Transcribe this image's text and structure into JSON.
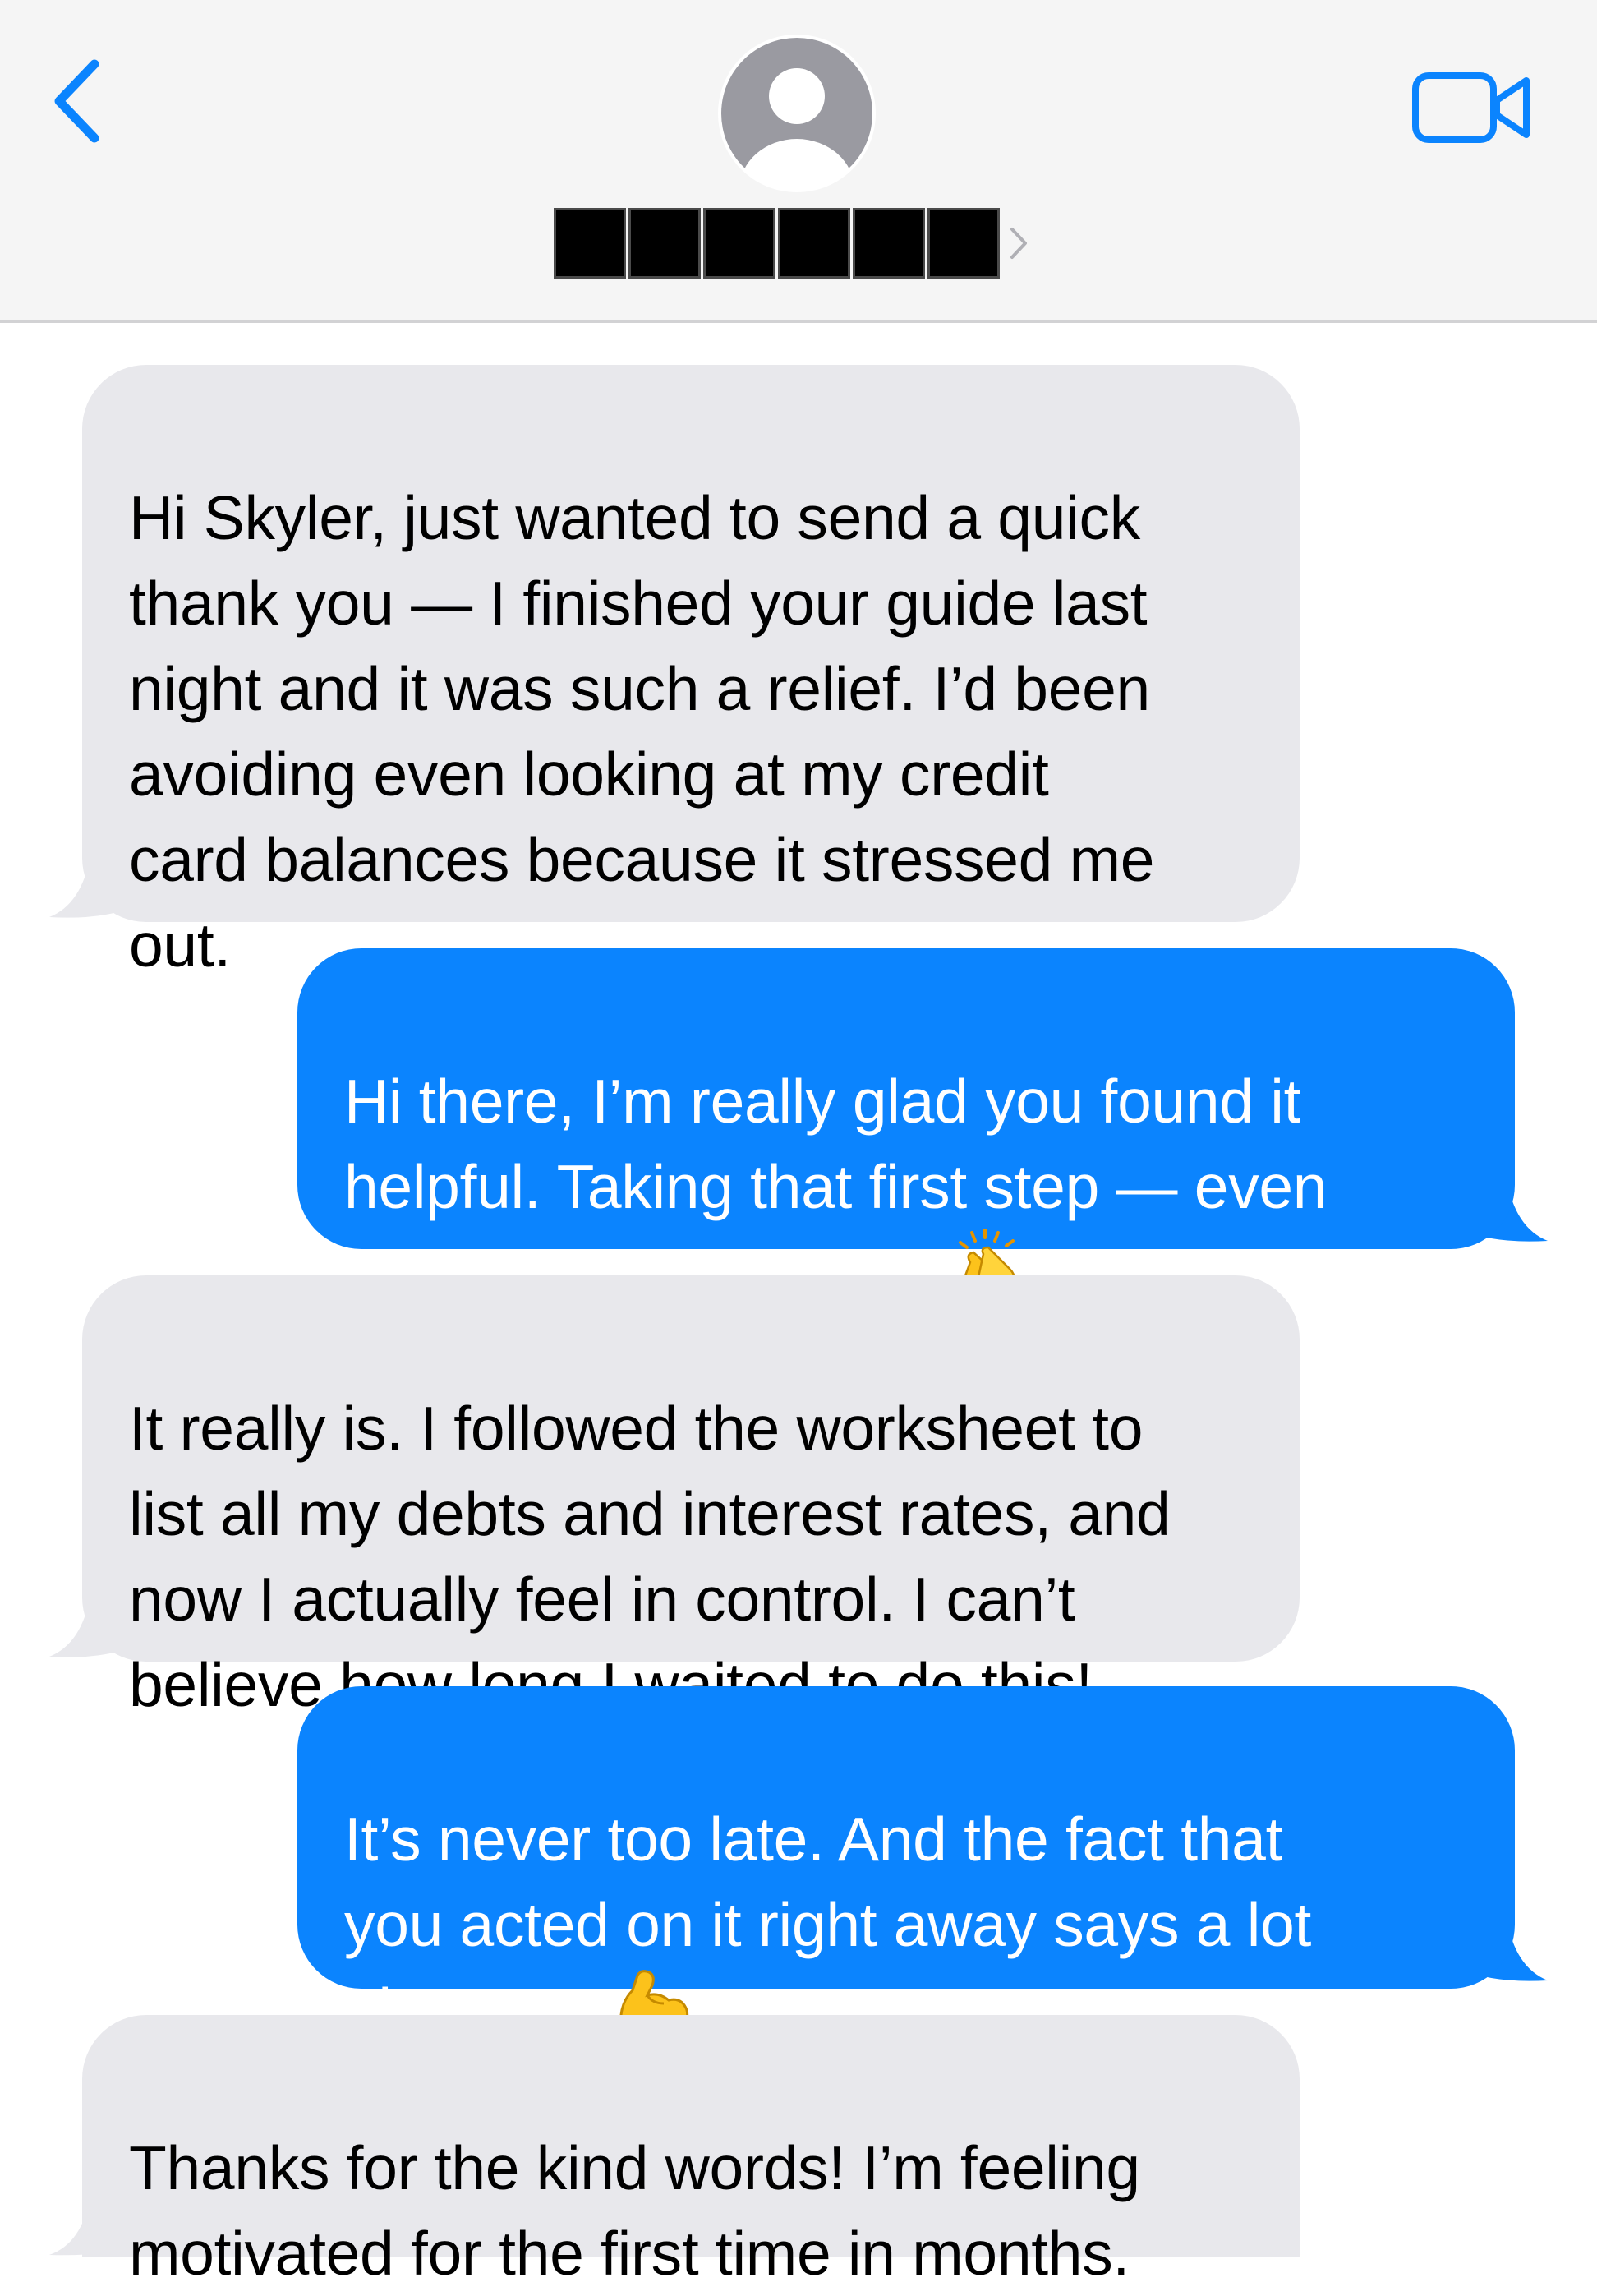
{
  "header": {
    "back_icon": "chevron-left-icon",
    "video_icon": "video-camera-icon",
    "avatar_icon": "person-silhouette-icon",
    "contact_name_redacted_cells": 6,
    "accent_color": "#0b84fe"
  },
  "messages": [
    {
      "direction": "received",
      "text": "Hi Skyler, just wanted to send a quick\nthank you — I finished your guide last\nnight and it was such a relief. I’d been\navoiding even looking at my credit\ncard balances because it stressed me\nout."
    },
    {
      "direction": "sent",
      "text": "Hi there, I’m really glad you found it\nhelpful. Taking that first step — even\njust reading — is huge",
      "emoji": "clapping-hands-emoji"
    },
    {
      "direction": "received",
      "text": "It really is. I followed the worksheet to\nlist all my debts and interest rates, and\nnow I actually feel in control. I can’t\nbelieve how long I waited to do this!"
    },
    {
      "direction": "sent",
      "text": "It’s never too late. And the fact that\nyou acted on it right away says a lot\nabout you",
      "emoji": "flexed-biceps-emoji"
    },
    {
      "direction": "received",
      "text": "Thanks for the kind words! I’m feeling\nmotivated for the first time in months."
    }
  ]
}
